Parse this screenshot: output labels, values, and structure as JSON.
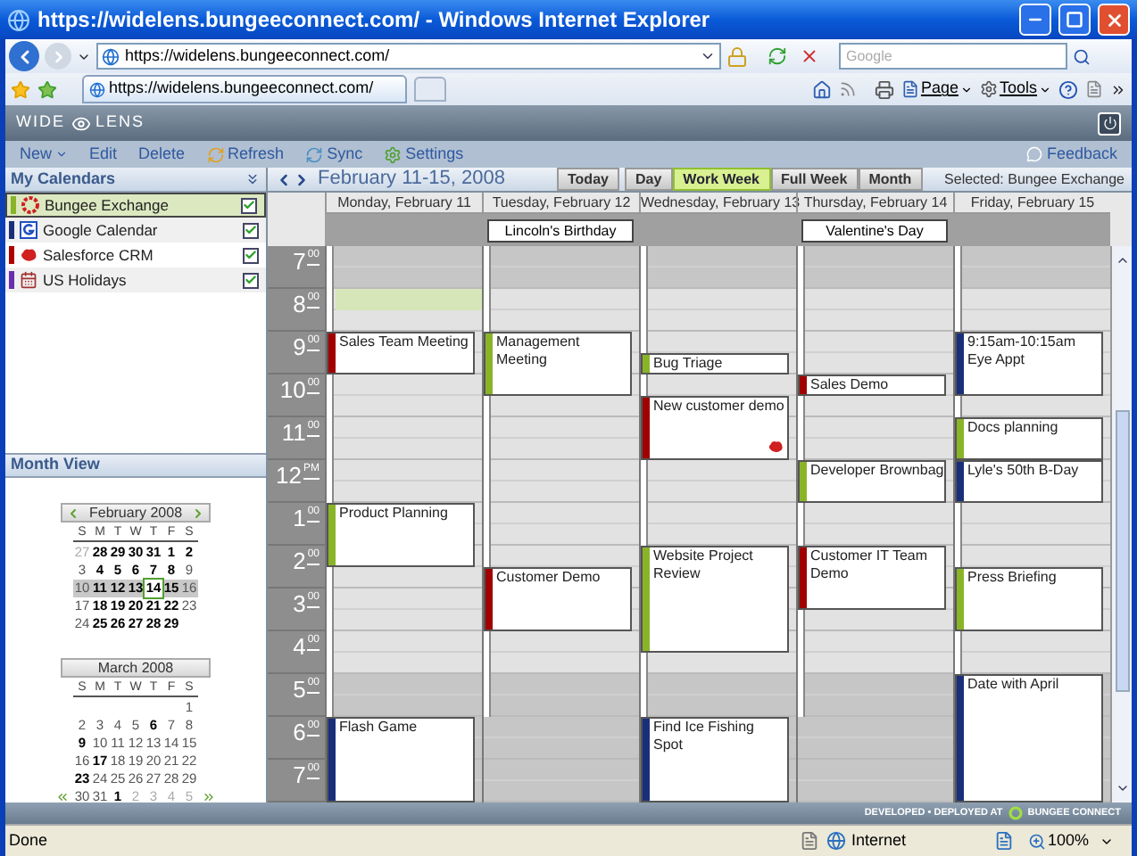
{
  "window": {
    "title": "https://widelens.bungeeconnect.com/ - Windows Internet Explorer"
  },
  "address_bar": {
    "url": "https://widelens.bungeeconnect.com/",
    "search_placeholder": "Google"
  },
  "browser_tab": {
    "label": "https://widelens.bungeeconnect.com/"
  },
  "command_bar": [
    "Page",
    "Tools"
  ],
  "app": {
    "logo_left": "WIDE",
    "logo_right": "LENS"
  },
  "toolbar": [
    {
      "label": "New",
      "kind": "menu"
    },
    {
      "label": "Edit",
      "kind": "plain"
    },
    {
      "label": "Delete",
      "kind": "plain"
    },
    {
      "label": "Refresh",
      "kind": "refresh"
    },
    {
      "label": "Sync",
      "kind": "sync"
    },
    {
      "label": "Settings",
      "kind": "settings"
    }
  ],
  "feedback": "Feedback",
  "my_calendars": {
    "title": "My Calendars",
    "items": [
      {
        "name": "Bungee Exchange",
        "kind": "bungee",
        "color": "#8ab428",
        "checked": true,
        "selected": true
      },
      {
        "name": "Google Calendar",
        "kind": "google",
        "color": "#1a2f7a",
        "checked": true,
        "selected": false
      },
      {
        "name": "Salesforce CRM",
        "kind": "salesforce",
        "color": "#b00000",
        "checked": true,
        "selected": false
      },
      {
        "name": "US Holidays",
        "kind": "holidays",
        "color": "#6a2fb0",
        "checked": true,
        "selected": false
      }
    ]
  },
  "month_view": {
    "title": "Month View",
    "months": [
      {
        "title": "February 2008",
        "kind": "prev_next",
        "weekdays": [
          "S",
          "M",
          "T",
          "W",
          "T",
          "F",
          "S"
        ],
        "weeks": [
          {
            "selected": false,
            "days": [
              {
                "day": "27",
                "kind": "other"
              },
              {
                "day": "28",
                "kind": "busy"
              },
              {
                "day": "29",
                "kind": "busy"
              },
              {
                "day": "30",
                "kind": "busy"
              },
              {
                "day": "31",
                "kind": "busy"
              },
              {
                "day": "1",
                "kind": "busy"
              },
              {
                "day": "2",
                "kind": "busy"
              }
            ]
          },
          {
            "selected": false,
            "days": [
              {
                "day": "3",
                "kind": "free"
              },
              {
                "day": "4",
                "kind": "busy"
              },
              {
                "day": "5",
                "kind": "busy"
              },
              {
                "day": "6",
                "kind": "busy"
              },
              {
                "day": "7",
                "kind": "busy"
              },
              {
                "day": "8",
                "kind": "busy"
              },
              {
                "day": "9",
                "kind": "free"
              }
            ]
          },
          {
            "selected": true,
            "days": [
              {
                "day": "10",
                "kind": "free"
              },
              {
                "day": "11",
                "kind": "busy"
              },
              {
                "day": "12",
                "kind": "busy"
              },
              {
                "day": "13",
                "kind": "busy"
              },
              {
                "day": "14",
                "kind": "today"
              },
              {
                "day": "15",
                "kind": "busy"
              },
              {
                "day": "16",
                "kind": "free"
              }
            ]
          },
          {
            "selected": false,
            "days": [
              {
                "day": "17",
                "kind": "free"
              },
              {
                "day": "18",
                "kind": "busy"
              },
              {
                "day": "19",
                "kind": "busy"
              },
              {
                "day": "20",
                "kind": "busy"
              },
              {
                "day": "21",
                "kind": "busy"
              },
              {
                "day": "22",
                "kind": "busy"
              },
              {
                "day": "23",
                "kind": "free"
              }
            ]
          },
          {
            "selected": false,
            "days": [
              {
                "day": "24",
                "kind": "free"
              },
              {
                "day": "25",
                "kind": "busy"
              },
              {
                "day": "26",
                "kind": "busy"
              },
              {
                "day": "27",
                "kind": "busy"
              },
              {
                "day": "28",
                "kind": "busy"
              },
              {
                "day": "29",
                "kind": "busy"
              },
              {
                "kind": "blank"
              }
            ]
          }
        ]
      },
      {
        "title": "March 2008",
        "kind": "first_last",
        "weekdays": [
          "S",
          "M",
          "T",
          "W",
          "T",
          "F",
          "S"
        ],
        "weeks": [
          {
            "selected": false,
            "days": [
              {
                "kind": "blank"
              },
              {
                "kind": "blank"
              },
              {
                "kind": "blank"
              },
              {
                "kind": "blank"
              },
              {
                "kind": "blank"
              },
              {
                "kind": "blank"
              },
              {
                "day": "1",
                "kind": "free"
              }
            ]
          },
          {
            "selected": false,
            "days": [
              {
                "day": "2",
                "kind": "free"
              },
              {
                "day": "3",
                "kind": "free"
              },
              {
                "day": "4",
                "kind": "free"
              },
              {
                "day": "5",
                "kind": "free"
              },
              {
                "day": "6",
                "kind": "busy"
              },
              {
                "day": "7",
                "kind": "free"
              },
              {
                "day": "8",
                "kind": "free"
              }
            ]
          },
          {
            "selected": false,
            "days": [
              {
                "day": "9",
                "kind": "busy"
              },
              {
                "day": "10",
                "kind": "free"
              },
              {
                "day": "11",
                "kind": "free"
              },
              {
                "day": "12",
                "kind": "free"
              },
              {
                "day": "13",
                "kind": "free"
              },
              {
                "day": "14",
                "kind": "free"
              },
              {
                "day": "15",
                "kind": "free"
              }
            ]
          },
          {
            "selected": false,
            "days": [
              {
                "day": "16",
                "kind": "free"
              },
              {
                "day": "17",
                "kind": "busy"
              },
              {
                "day": "18",
                "kind": "free"
              },
              {
                "day": "19",
                "kind": "free"
              },
              {
                "day": "20",
                "kind": "free"
              },
              {
                "day": "21",
                "kind": "free"
              },
              {
                "day": "22",
                "kind": "free"
              }
            ]
          },
          {
            "selected": false,
            "days": [
              {
                "day": "23",
                "kind": "busy"
              },
              {
                "day": "24",
                "kind": "free"
              },
              {
                "day": "25",
                "kind": "free"
              },
              {
                "day": "26",
                "kind": "free"
              },
              {
                "day": "27",
                "kind": "free"
              },
              {
                "day": "28",
                "kind": "free"
              },
              {
                "day": "29",
                "kind": "free"
              }
            ]
          },
          {
            "selected": false,
            "days": [
              {
                "day": "30",
                "kind": "free"
              },
              {
                "day": "31",
                "kind": "free"
              },
              {
                "day": "1",
                "kind": "busy"
              },
              {
                "day": "2",
                "kind": "other"
              },
              {
                "day": "3",
                "kind": "other"
              },
              {
                "day": "4",
                "kind": "other"
              },
              {
                "day": "5",
                "kind": "other"
              }
            ]
          }
        ]
      }
    ]
  },
  "calendar": {
    "range": "February 11-15, 2008",
    "views": [
      {
        "label": "Today",
        "selected": false
      },
      {
        "label": "Day",
        "selected": false
      },
      {
        "label": "Work Week",
        "selected": true
      },
      {
        "label": "Full Week",
        "selected": false
      },
      {
        "label": "Month",
        "selected": false
      }
    ],
    "selected_text": "Selected: Bungee Exchange",
    "hours": [
      {
        "hour": "7",
        "suffix": "00"
      },
      {
        "hour": "8",
        "suffix": "00"
      },
      {
        "hour": "9",
        "suffix": "00"
      },
      {
        "hour": "10",
        "suffix": "00"
      },
      {
        "hour": "11",
        "suffix": "00"
      },
      {
        "hour": "12",
        "suffix": "PM"
      },
      {
        "hour": "1",
        "suffix": "00"
      },
      {
        "hour": "2",
        "suffix": "00"
      },
      {
        "hour": "3",
        "suffix": "00"
      },
      {
        "hour": "4",
        "suffix": "00"
      },
      {
        "hour": "5",
        "suffix": "00"
      },
      {
        "hour": "6",
        "suffix": "00"
      },
      {
        "hour": "7",
        "suffix": "00"
      }
    ],
    "days": [
      {
        "header": "Monday, February 11",
        "events": [
          {
            "title": "Sales Team Meeting",
            "color": "#a00000",
            "badge": false
          },
          {
            "title": "Product Planning",
            "color": "#8ab428",
            "badge": false
          },
          {
            "title": "Flash Game",
            "color": "#1a2f7a",
            "badge": false
          }
        ]
      },
      {
        "header": "Tuesday, February 12",
        "all_day": "Lincoln's Birthday",
        "events": [
          {
            "title": "Management Meeting",
            "color": "#8ab428",
            "badge": false
          },
          {
            "title": "Customer Demo",
            "color": "#a00000",
            "badge": false
          }
        ]
      },
      {
        "header": "Wednesday, February 13",
        "events": [
          {
            "title": "Bug Triage",
            "color": "#8ab428",
            "badge": false
          },
          {
            "title": "New customer demo",
            "color": "#a00000",
            "badge": true
          },
          {
            "title": "Website Project Review",
            "color": "#8ab428",
            "badge": false
          },
          {
            "title": "Find Ice Fishing Spot",
            "color": "#1a2f7a",
            "badge": false
          }
        ]
      },
      {
        "header": "Thursday, February 14",
        "all_day": "Valentine's Day",
        "events": [
          {
            "title": "Sales Demo",
            "color": "#a00000",
            "badge": false
          },
          {
            "title": "Developer Brownbag",
            "color": "#8ab428",
            "badge": false
          },
          {
            "title": "Customer IT Team Demo",
            "color": "#a00000",
            "badge": false
          }
        ]
      },
      {
        "header": "Friday, February 15",
        "events": [
          {
            "title": "9:15am-10:15am Eye Appt",
            "color": "#1a2f7a",
            "badge": false
          },
          {
            "title": "Docs planning",
            "color": "#8ab428",
            "badge": false
          },
          {
            "title": "Lyle's 50th B-Day",
            "color": "#1a2f7a",
            "badge": false
          },
          {
            "title": "Press Briefing",
            "color": "#8ab428",
            "badge": false
          },
          {
            "title": "Date with April",
            "color": "#1a2f7a",
            "badge": false
          }
        ]
      }
    ]
  },
  "footer": {
    "left": "DEVELOPED • DEPLOYED AT",
    "right": "BUNGEE CONNECT"
  },
  "status_bar": {
    "text": "Done",
    "zone": "Internet",
    "zoom": "100%"
  }
}
